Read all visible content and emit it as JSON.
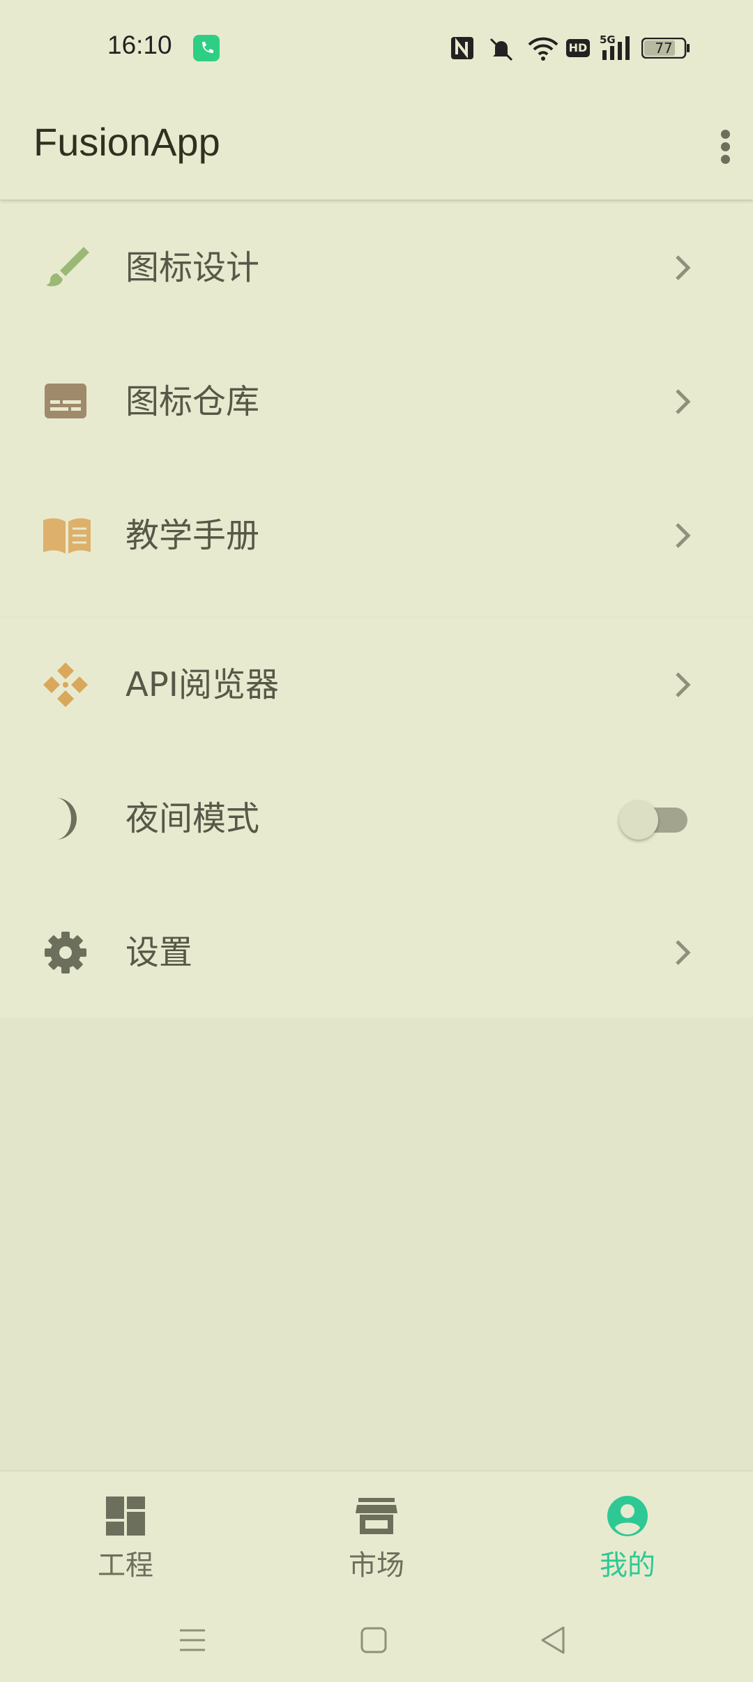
{
  "status_bar": {
    "time": "16:10",
    "battery_level": "77",
    "network_badge": "HD",
    "signal_type": "5G",
    "icons": [
      "nfc-icon",
      "mute-icon",
      "wifi-icon",
      "hd-icon",
      "signal-icon",
      "battery-icon"
    ]
  },
  "app_bar": {
    "title": "FusionApp"
  },
  "menu": {
    "section1": [
      {
        "label": "图标设计",
        "icon": "brush-icon",
        "color": "#9cb877"
      },
      {
        "label": "图标仓库",
        "icon": "storage-icon",
        "color": "#a08a6c"
      },
      {
        "label": "教学手册",
        "icon": "book-icon",
        "color": "#ddb06c"
      }
    ],
    "section2": [
      {
        "label": "API阅览器",
        "icon": "api-icon",
        "color": "#d9a85c"
      },
      {
        "label": "夜间模式",
        "icon": "moon-icon",
        "color": "#6c6f5b",
        "toggle_on": false
      },
      {
        "label": "设置",
        "icon": "gear-icon",
        "color": "#6c6f5b"
      }
    ]
  },
  "bottom_nav": {
    "items": [
      {
        "label": "工程",
        "icon": "dashboard-icon",
        "active": false
      },
      {
        "label": "市场",
        "icon": "store-icon",
        "active": false
      },
      {
        "label": "我的",
        "icon": "account-icon",
        "active": true
      }
    ]
  },
  "colors": {
    "accent": "#2ec895",
    "background": "#e3e5cb",
    "surface": "#e8eacf"
  }
}
